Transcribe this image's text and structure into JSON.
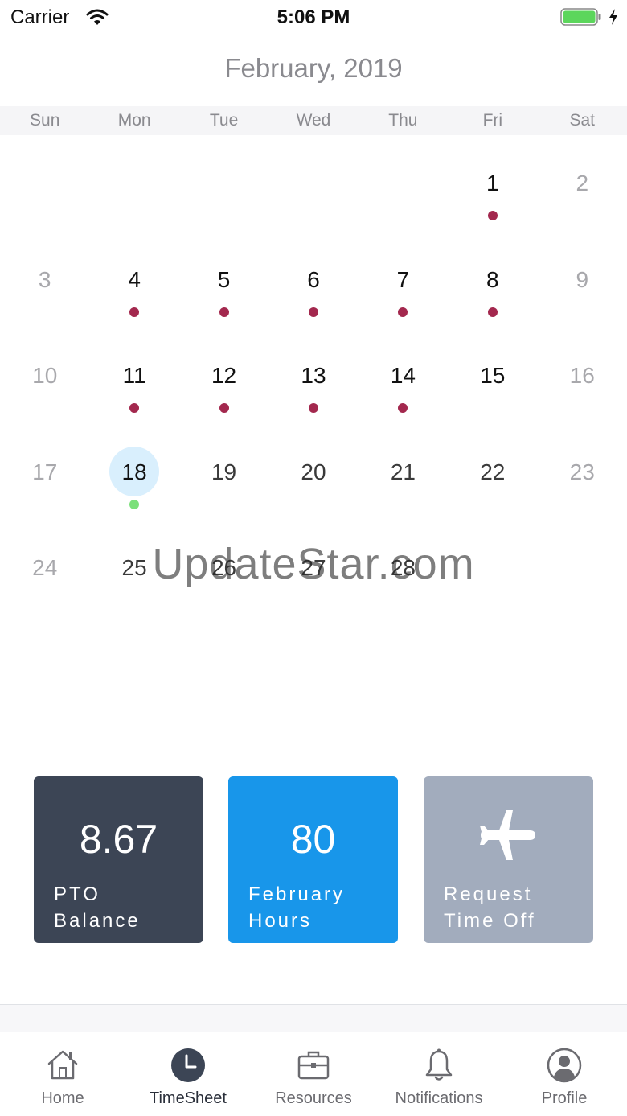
{
  "status_bar": {
    "carrier": "Carrier",
    "time": "5:06 PM",
    "battery_color": "#5cd65c"
  },
  "calendar": {
    "month_title": "February, 2019",
    "weekdays": [
      "Sun",
      "Mon",
      "Tue",
      "Wed",
      "Thu",
      "Fri",
      "Sat"
    ],
    "weeks": [
      [
        null,
        null,
        null,
        null,
        null,
        {
          "day": "1",
          "dot": true
        },
        {
          "day": "2",
          "weekend": true
        }
      ],
      [
        {
          "day": "3",
          "weekend": true
        },
        {
          "day": "4",
          "dot": true
        },
        {
          "day": "5",
          "dot": true
        },
        {
          "day": "6",
          "dot": true
        },
        {
          "day": "7",
          "dot": true
        },
        {
          "day": "8",
          "dot": true
        },
        {
          "day": "9",
          "weekend": true
        }
      ],
      [
        {
          "day": "10",
          "weekend": true
        },
        {
          "day": "11",
          "dot": true
        },
        {
          "day": "12",
          "dot": true
        },
        {
          "day": "13",
          "dot": true
        },
        {
          "day": "14",
          "dot": true
        },
        {
          "day": "15"
        },
        {
          "day": "16",
          "weekend": true
        }
      ],
      [
        {
          "day": "17",
          "weekend": true
        },
        {
          "day": "18",
          "today": true,
          "dot": true
        },
        {
          "day": "19",
          "future": true
        },
        {
          "day": "20",
          "future": true
        },
        {
          "day": "21",
          "future": true
        },
        {
          "day": "22",
          "future": true
        },
        {
          "day": "23",
          "weekend": true
        }
      ],
      [
        {
          "day": "24",
          "weekend": true
        },
        {
          "day": "25",
          "future": true
        },
        {
          "day": "26",
          "future": true
        },
        {
          "day": "27",
          "future": true
        },
        {
          "day": "28",
          "future": true
        },
        null,
        null
      ]
    ],
    "dot_color": "#a3284e",
    "today_dot_color": "#7be07a",
    "today_highlight_color": "#d9effd"
  },
  "watermark": "UpdateStar.com",
  "cards": {
    "pto": {
      "value": "8.67",
      "label_line1": "PTO",
      "label_line2": "Balance",
      "color": "#3c4555"
    },
    "hours": {
      "value": "80",
      "label_line1": "February",
      "label_line2": "Hours",
      "color": "#1896ea"
    },
    "request": {
      "icon": "airplane-icon",
      "label_line1": "Request",
      "label_line2": "Time Off",
      "color": "#a2acbd"
    }
  },
  "tab_bar": {
    "tabs": [
      {
        "label": "Home",
        "icon": "home-icon"
      },
      {
        "label": "TimeSheet",
        "icon": "clock-icon",
        "active": true
      },
      {
        "label": "Resources",
        "icon": "briefcase-icon"
      },
      {
        "label": "Notifications",
        "icon": "bell-icon"
      },
      {
        "label": "Profile",
        "icon": "person-icon"
      }
    ]
  }
}
